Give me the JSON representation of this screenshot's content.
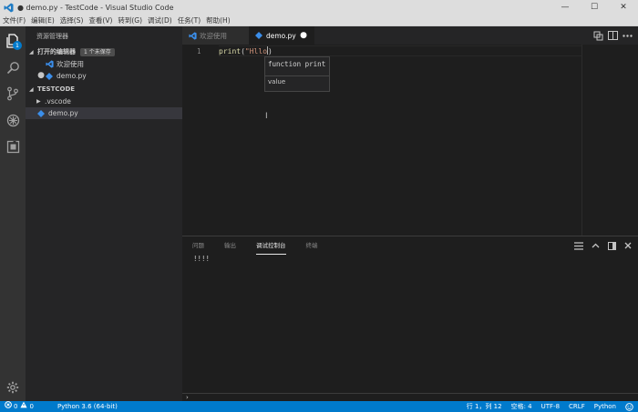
{
  "window": {
    "title": "● demo.py - TestCode - Visual Studio Code",
    "controls": [
      "—",
      "☐",
      "✕"
    ]
  },
  "menu": [
    "文件(F)",
    "编辑(E)",
    "选择(S)",
    "查看(V)",
    "转到(G)",
    "调试(D)",
    "任务(T)",
    "帮助(H)"
  ],
  "activity": {
    "explorer_badge": "1"
  },
  "sidebar": {
    "title": "资源管理器",
    "open_editors": {
      "header": "打开的编辑器",
      "badge": "1 个未保存",
      "items": [
        {
          "name": "欢迎使用",
          "dirty": false
        },
        {
          "name": "demo.py",
          "dirty": true
        }
      ]
    },
    "folder": {
      "header": "TESTCODE",
      "items": [
        {
          "name": ".vscode",
          "type": "folder"
        },
        {
          "name": "demo.py",
          "type": "python"
        }
      ]
    }
  },
  "tabs": [
    {
      "label": "欢迎使用",
      "active": false
    },
    {
      "label": "demo.py",
      "active": true,
      "dirty_mark": "●"
    }
  ],
  "editor": {
    "line_number": "1",
    "code": {
      "fn": "print",
      "open": "(",
      "str": "\"Hllo",
      "close": ")"
    },
    "suggest": {
      "signature": "function print",
      "item": "value"
    }
  },
  "panel": {
    "tabs": [
      "问题",
      "输出",
      "调试控制台",
      "终端"
    ],
    "active_tab": "调试控制台",
    "output": "!!!!",
    "prompt": "›"
  },
  "status": {
    "errors": "0",
    "warnings": "0",
    "interpreter": "Python 3.6 (64-bit)",
    "position": "行 1，列 12",
    "indent": "空格: 4",
    "encoding": "UTF-8",
    "eol": "CRLF",
    "language": "Python"
  },
  "colors": {
    "accent": "#007acc",
    "activity_bg": "#333333",
    "sidebar_bg": "#252526",
    "editor_bg": "#1e1e1e",
    "python_icon": "#3b8eea"
  }
}
